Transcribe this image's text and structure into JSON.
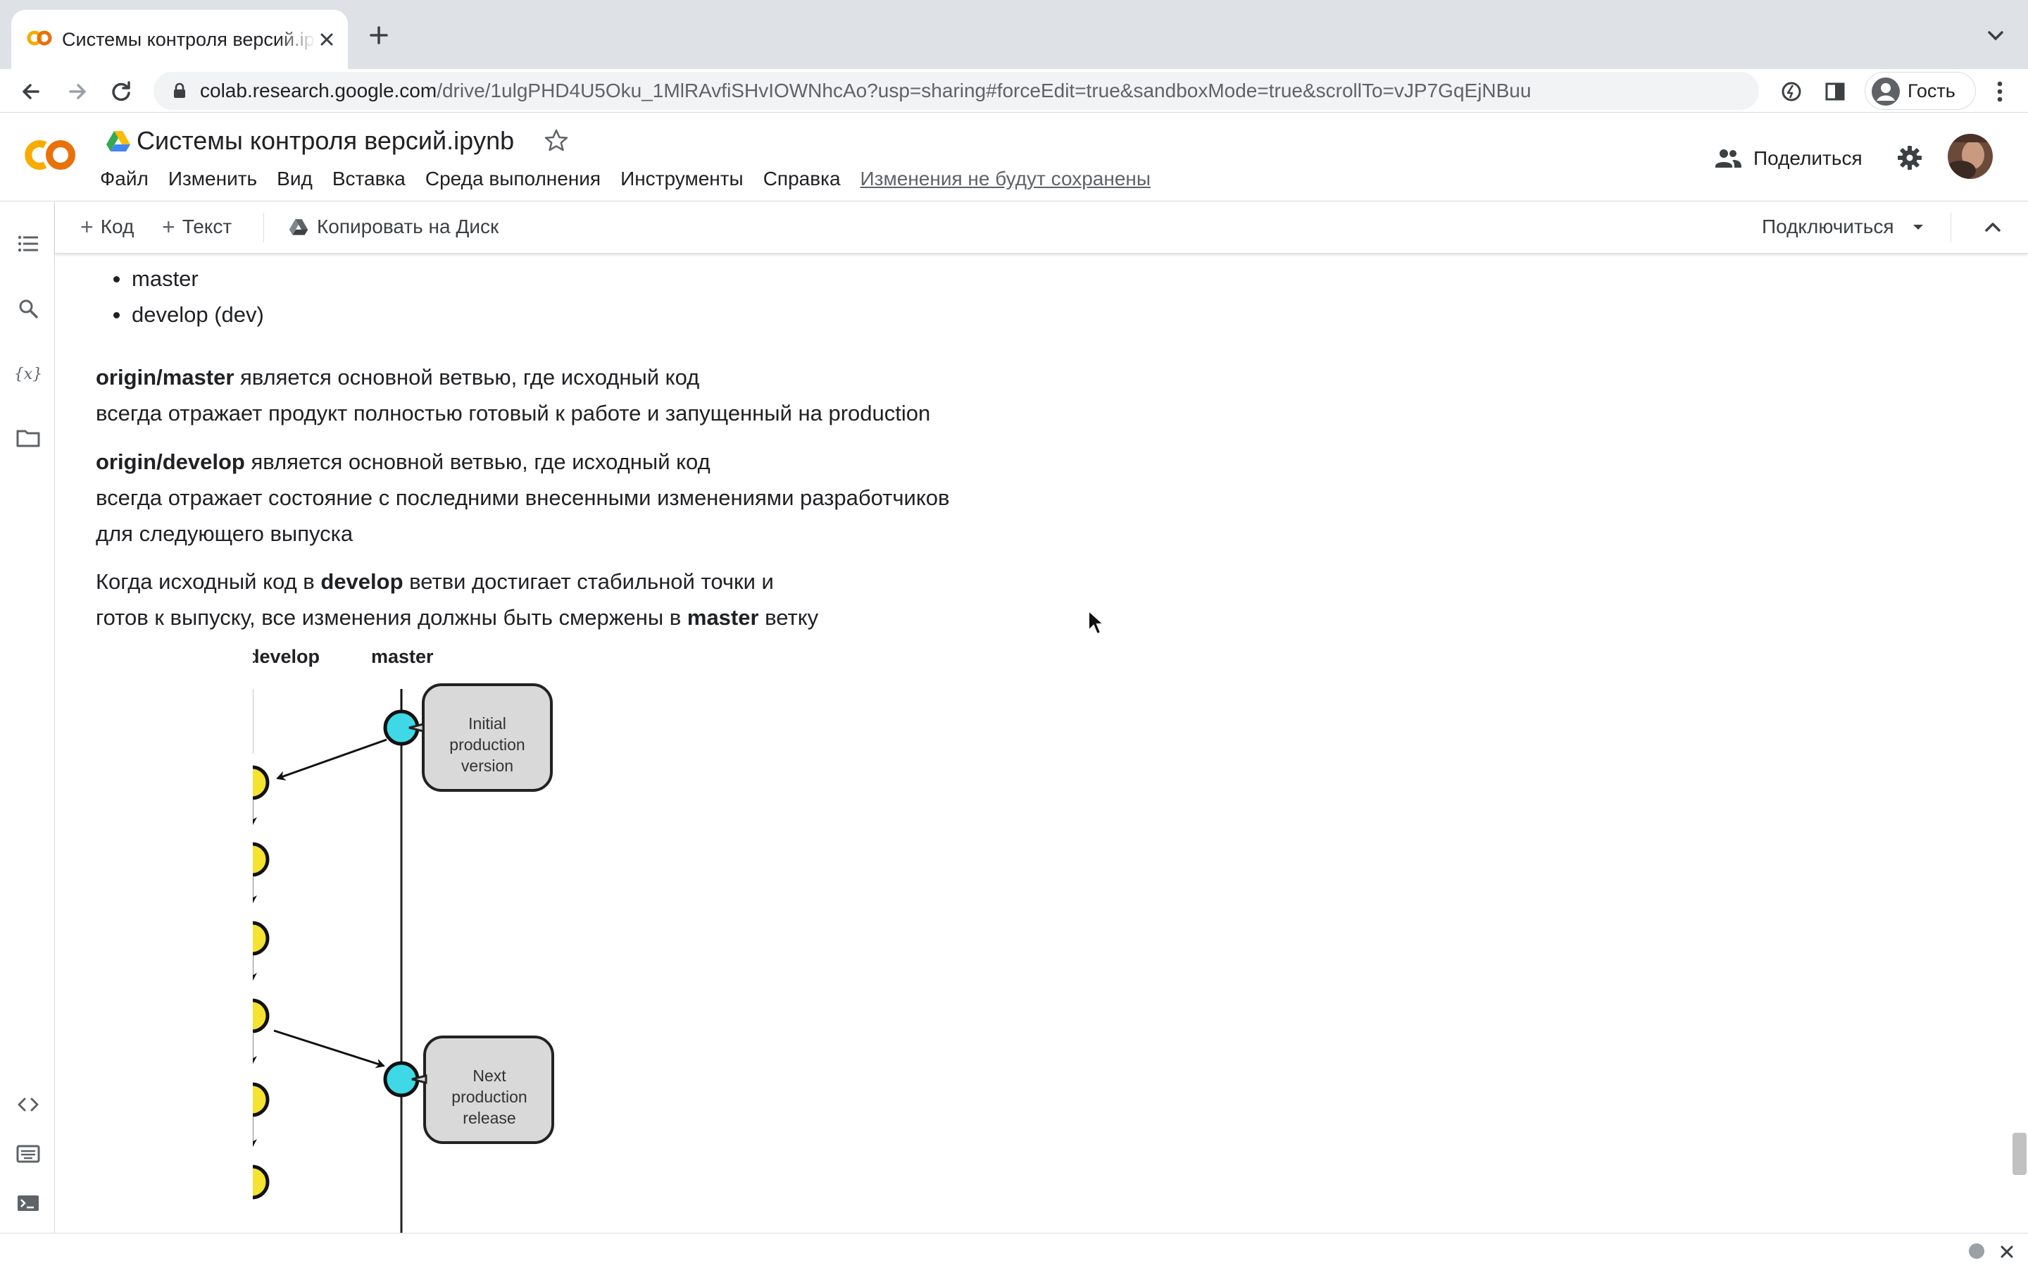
{
  "browser": {
    "tab_title": "Системы контроля версий.ipynb",
    "url_host": "colab.research.google.com",
    "url_path": "/drive/1ulgPHD4U5Oku_1MlRAvfiSHvIOWNhcAo?usp=sharing#forceEdit=true&sandboxMode=true&scrollTo=vJP7GqEjNBuu",
    "profile_label": "Гость"
  },
  "colab": {
    "logo_text": "CO",
    "doc_title": "Системы контроля версий.ipynb",
    "menu": [
      "Файл",
      "Изменить",
      "Вид",
      "Вставка",
      "Среда выполнения",
      "Инструменты",
      "Справка"
    ],
    "unsaved_label": "Изменения не будут сохранены",
    "share_label": "Поделиться"
  },
  "toolbar": {
    "add_code": "Код",
    "add_text": "Текст",
    "copy_to_drive": "Копировать на Диск",
    "connect": "Подключиться"
  },
  "content": {
    "bullets": [
      "master",
      "develop (dev)"
    ],
    "p1_bold": "origin/master",
    "p1_rest": " является основной ветвью, где исходный код",
    "p1_line2": "всегда отражает продукт полностью готовый к работе и запущенный на production",
    "p2_bold": "origin/develop",
    "p2_rest": " является основной ветвью, где исходный код",
    "p2_line2": "всегда отражает состояние с последними внесенными изменениями разработчиков",
    "p2_line3": "для следующего выпуска",
    "p3_a": "Когда исходный код в ",
    "p3_b": "develop",
    "p3_c": " ветви достигает стабильной точки и",
    "p4_a": "готов к выпуску, все изменения должны быть смержены в ",
    "p4_b": "master",
    "p4_c": " ветку"
  },
  "diagram": {
    "develop_label": "develop",
    "master_label": "master",
    "bubble1": [
      "Initial",
      "production",
      "version"
    ],
    "bubble2": [
      "Next",
      "production",
      "release"
    ],
    "colors": {
      "develop_node": "#f5e231",
      "master_node": "#3ed8e6",
      "bubble_fill": "#d9d9d9"
    }
  },
  "icons": {
    "rail": [
      "table-of-contents-icon",
      "search-icon",
      "variables-icon",
      "files-icon",
      "code-snippets-icon",
      "command-palette-icon",
      "terminal-icon"
    ]
  }
}
